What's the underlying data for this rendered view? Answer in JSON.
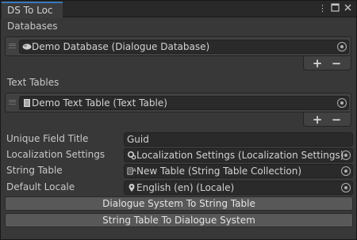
{
  "window": {
    "tab_title": "DS To Loc",
    "menu_icon": "kebab-menu-icon",
    "maximize_icon": "maximize-icon",
    "close_icon": "close-icon"
  },
  "databases": {
    "header": "Databases",
    "items": [
      {
        "label": "Demo Database (Dialogue Database)",
        "icon": "database-icon"
      }
    ],
    "add": "+",
    "remove": "−"
  },
  "text_tables": {
    "header": "Text Tables",
    "items": [
      {
        "label": "Demo Text Table (Text Table)",
        "icon": "text-table-icon"
      }
    ],
    "add": "+",
    "remove": "−"
  },
  "fields": {
    "unique_field_title": {
      "label": "Unique Field Title",
      "value": "Guid"
    },
    "localization_settings": {
      "label": "Localization Settings",
      "value": "Localization Settings (Localization Settings)",
      "icon": "localization-settings-icon"
    },
    "string_table": {
      "label": "String Table",
      "value": "New Table (String Table Collection)",
      "icon": "string-table-icon"
    },
    "default_locale": {
      "label": "Default Locale",
      "value": "English (en) (Locale)",
      "icon": "locale-pin-icon"
    }
  },
  "buttons": {
    "to_string_table": "Dialogue System To String Table",
    "to_dialogue_system": "String Table To Dialogue System"
  },
  "colors": {
    "tab_accent": "#3a79bb",
    "panel": "#383838",
    "field": "#2a2a2a",
    "button": "#585858"
  }
}
